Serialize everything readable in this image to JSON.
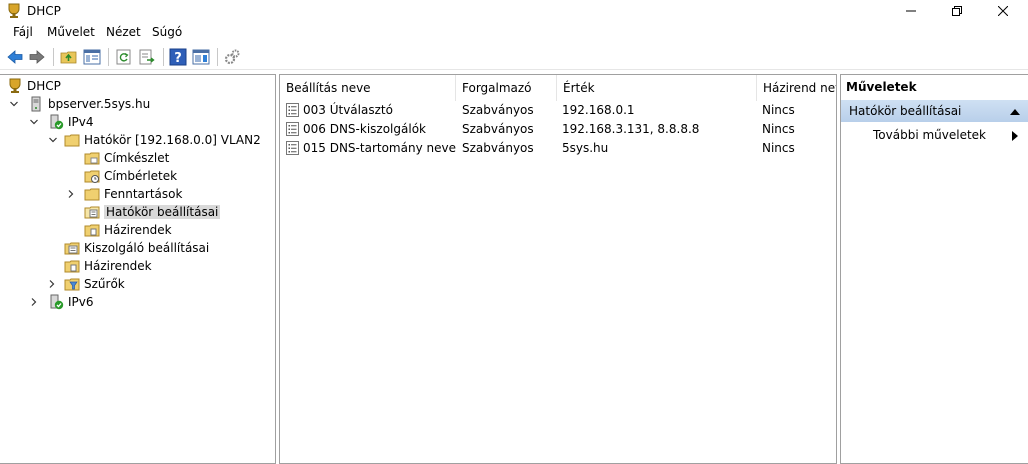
{
  "window": {
    "title": "DHCP"
  },
  "menu": [
    "Fájl",
    "Művelet",
    "Nézet",
    "Súgó"
  ],
  "tree": {
    "root": "DHCP",
    "server": "bpserver.5sys.hu",
    "ipv4": "IPv4",
    "scope": "Hatókör [192.168.0.0] VLAN2",
    "address_pool": "Címkészlet",
    "address_leases": "Címbérletek",
    "reservations": "Fenntartások",
    "scope_options": "Hatókör beállításai",
    "scope_policies": "Házirendek",
    "server_options": "Kiszolgáló beállításai",
    "policies": "Házirendek",
    "filters": "Szűrők",
    "ipv6": "IPv6"
  },
  "list": {
    "columns": [
      "Beállítás neve",
      "Forgalmazó",
      "Érték",
      "Házirend neve"
    ],
    "rows": [
      {
        "name": "003 Útválasztó",
        "vendor": "Szabványos",
        "value": "192.168.0.1",
        "policy": "Nincs"
      },
      {
        "name": "006 DNS-kiszolgálók",
        "vendor": "Szabványos",
        "value": "192.168.3.131, 8.8.8.8",
        "policy": "Nincs"
      },
      {
        "name": "015 DNS-tartomány neve",
        "vendor": "Szabványos",
        "value": "5sys.hu",
        "policy": "Nincs"
      }
    ]
  },
  "actions": {
    "title": "Műveletek",
    "section": "Hatókör beállításai",
    "more": "További műveletek"
  },
  "colors": {
    "selection": "#d9d9d9",
    "action_header": "#c4d7ee",
    "border": "#a0a0a0"
  }
}
